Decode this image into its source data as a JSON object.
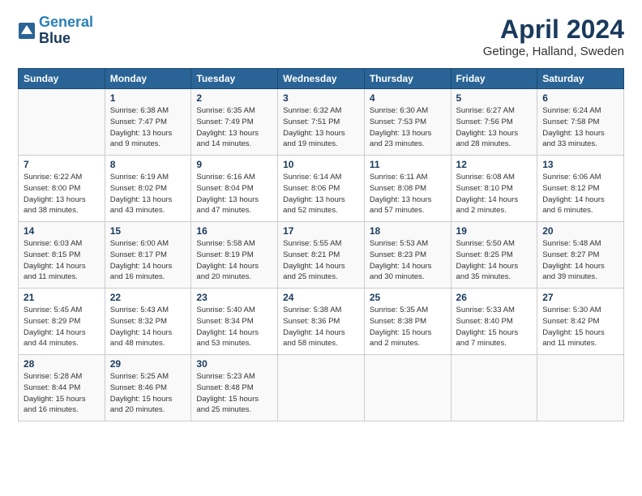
{
  "header": {
    "logo_line1": "General",
    "logo_line2": "Blue",
    "month": "April 2024",
    "location": "Getinge, Halland, Sweden"
  },
  "days_of_week": [
    "Sunday",
    "Monday",
    "Tuesday",
    "Wednesday",
    "Thursday",
    "Friday",
    "Saturday"
  ],
  "weeks": [
    [
      {
        "day": "",
        "info": ""
      },
      {
        "day": "1",
        "info": "Sunrise: 6:38 AM\nSunset: 7:47 PM\nDaylight: 13 hours\nand 9 minutes."
      },
      {
        "day": "2",
        "info": "Sunrise: 6:35 AM\nSunset: 7:49 PM\nDaylight: 13 hours\nand 14 minutes."
      },
      {
        "day": "3",
        "info": "Sunrise: 6:32 AM\nSunset: 7:51 PM\nDaylight: 13 hours\nand 19 minutes."
      },
      {
        "day": "4",
        "info": "Sunrise: 6:30 AM\nSunset: 7:53 PM\nDaylight: 13 hours\nand 23 minutes."
      },
      {
        "day": "5",
        "info": "Sunrise: 6:27 AM\nSunset: 7:56 PM\nDaylight: 13 hours\nand 28 minutes."
      },
      {
        "day": "6",
        "info": "Sunrise: 6:24 AM\nSunset: 7:58 PM\nDaylight: 13 hours\nand 33 minutes."
      }
    ],
    [
      {
        "day": "7",
        "info": "Sunrise: 6:22 AM\nSunset: 8:00 PM\nDaylight: 13 hours\nand 38 minutes."
      },
      {
        "day": "8",
        "info": "Sunrise: 6:19 AM\nSunset: 8:02 PM\nDaylight: 13 hours\nand 43 minutes."
      },
      {
        "day": "9",
        "info": "Sunrise: 6:16 AM\nSunset: 8:04 PM\nDaylight: 13 hours\nand 47 minutes."
      },
      {
        "day": "10",
        "info": "Sunrise: 6:14 AM\nSunset: 8:06 PM\nDaylight: 13 hours\nand 52 minutes."
      },
      {
        "day": "11",
        "info": "Sunrise: 6:11 AM\nSunset: 8:08 PM\nDaylight: 13 hours\nand 57 minutes."
      },
      {
        "day": "12",
        "info": "Sunrise: 6:08 AM\nSunset: 8:10 PM\nDaylight: 14 hours\nand 2 minutes."
      },
      {
        "day": "13",
        "info": "Sunrise: 6:06 AM\nSunset: 8:12 PM\nDaylight: 14 hours\nand 6 minutes."
      }
    ],
    [
      {
        "day": "14",
        "info": "Sunrise: 6:03 AM\nSunset: 8:15 PM\nDaylight: 14 hours\nand 11 minutes."
      },
      {
        "day": "15",
        "info": "Sunrise: 6:00 AM\nSunset: 8:17 PM\nDaylight: 14 hours\nand 16 minutes."
      },
      {
        "day": "16",
        "info": "Sunrise: 5:58 AM\nSunset: 8:19 PM\nDaylight: 14 hours\nand 20 minutes."
      },
      {
        "day": "17",
        "info": "Sunrise: 5:55 AM\nSunset: 8:21 PM\nDaylight: 14 hours\nand 25 minutes."
      },
      {
        "day": "18",
        "info": "Sunrise: 5:53 AM\nSunset: 8:23 PM\nDaylight: 14 hours\nand 30 minutes."
      },
      {
        "day": "19",
        "info": "Sunrise: 5:50 AM\nSunset: 8:25 PM\nDaylight: 14 hours\nand 35 minutes."
      },
      {
        "day": "20",
        "info": "Sunrise: 5:48 AM\nSunset: 8:27 PM\nDaylight: 14 hours\nand 39 minutes."
      }
    ],
    [
      {
        "day": "21",
        "info": "Sunrise: 5:45 AM\nSunset: 8:29 PM\nDaylight: 14 hours\nand 44 minutes."
      },
      {
        "day": "22",
        "info": "Sunrise: 5:43 AM\nSunset: 8:32 PM\nDaylight: 14 hours\nand 48 minutes."
      },
      {
        "day": "23",
        "info": "Sunrise: 5:40 AM\nSunset: 8:34 PM\nDaylight: 14 hours\nand 53 minutes."
      },
      {
        "day": "24",
        "info": "Sunrise: 5:38 AM\nSunset: 8:36 PM\nDaylight: 14 hours\nand 58 minutes."
      },
      {
        "day": "25",
        "info": "Sunrise: 5:35 AM\nSunset: 8:38 PM\nDaylight: 15 hours\nand 2 minutes."
      },
      {
        "day": "26",
        "info": "Sunrise: 5:33 AM\nSunset: 8:40 PM\nDaylight: 15 hours\nand 7 minutes."
      },
      {
        "day": "27",
        "info": "Sunrise: 5:30 AM\nSunset: 8:42 PM\nDaylight: 15 hours\nand 11 minutes."
      }
    ],
    [
      {
        "day": "28",
        "info": "Sunrise: 5:28 AM\nSunset: 8:44 PM\nDaylight: 15 hours\nand 16 minutes."
      },
      {
        "day": "29",
        "info": "Sunrise: 5:25 AM\nSunset: 8:46 PM\nDaylight: 15 hours\nand 20 minutes."
      },
      {
        "day": "30",
        "info": "Sunrise: 5:23 AM\nSunset: 8:48 PM\nDaylight: 15 hours\nand 25 minutes."
      },
      {
        "day": "",
        "info": ""
      },
      {
        "day": "",
        "info": ""
      },
      {
        "day": "",
        "info": ""
      },
      {
        "day": "",
        "info": ""
      }
    ]
  ]
}
